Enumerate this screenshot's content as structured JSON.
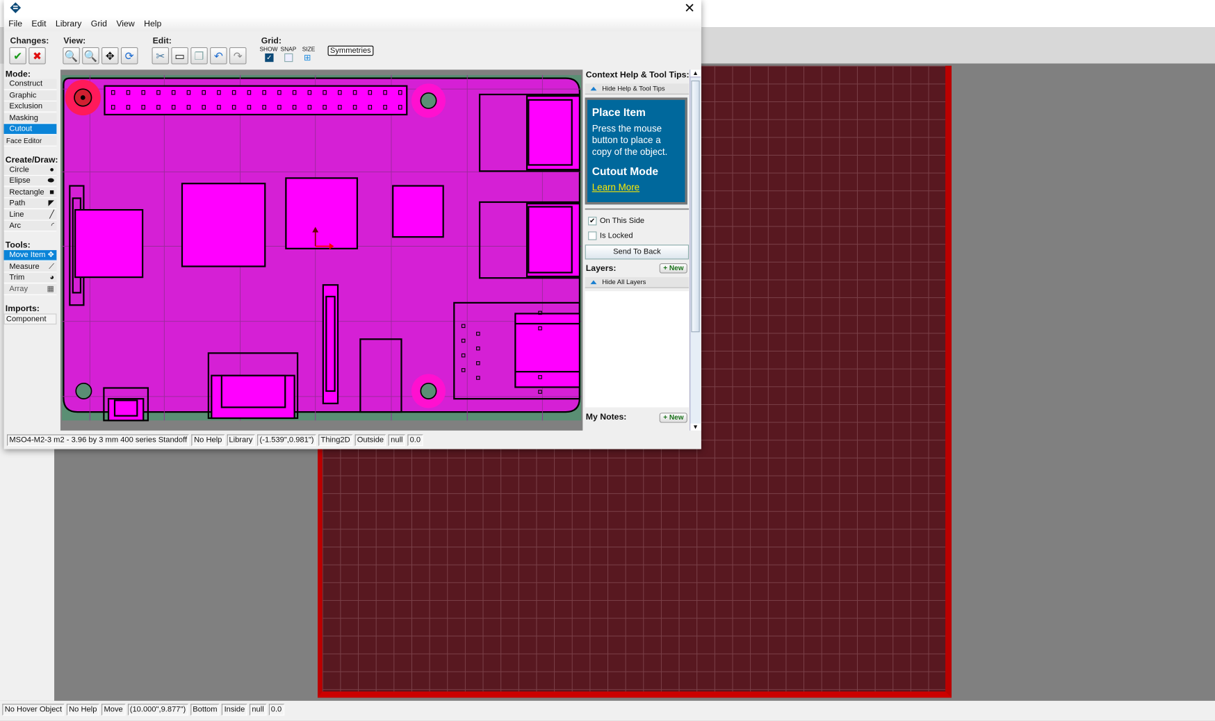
{
  "menu": [
    "File",
    "Edit",
    "Library",
    "Grid",
    "View",
    "Help"
  ],
  "toolbar": {
    "changes": "Changes:",
    "view": "View:",
    "edit": "Edit:",
    "grid": "Grid:",
    "show": "SHOW",
    "snap": "SNAP",
    "size": "SIZE",
    "symmetries": "Symmetries",
    "show_checked": true,
    "snap_checked": false
  },
  "left": {
    "mode_label": "Mode:",
    "modes": [
      "Construct",
      "Graphic",
      "Exclusion",
      "Masking",
      "Cutout",
      "Face Editor"
    ],
    "selected_mode": "Cutout",
    "create_label": "Create/Draw:",
    "create": [
      "Circle",
      "Elipse",
      "Rectangle",
      "Path",
      "Line",
      "Arc"
    ],
    "tools_label": "Tools:",
    "tools": [
      "Move Item",
      "Measure",
      "Trim",
      "Array"
    ],
    "selected_tool": "Move Item",
    "imports_label": "Imports:",
    "imports": [
      "Component"
    ]
  },
  "right": {
    "help_title": "Context Help & Tool Tips:",
    "hide_help": "Hide Help & Tool Tips",
    "tip_title": "Place Item",
    "tip_body": "Press the mouse button to place a copy of the object.",
    "tip_mode": "Cutout Mode",
    "learn_more": "Learn More",
    "on_this_side": "On This Side",
    "on_this_side_checked": true,
    "is_locked": "Is Locked",
    "is_locked_checked": false,
    "send_to_back": "Send To Back",
    "layers": "Layers:",
    "new": "+ New",
    "hide_layers": "Hide All Layers",
    "notes": "My Notes:"
  },
  "status": [
    "MSO4-M2-3 m2 - 3.96 by 3 mm 400 series Standoff",
    "No Help",
    "Library",
    "(-1.539\",0.981\")",
    "Thing2D",
    "Outside",
    "null",
    "0.0"
  ],
  "main_status": [
    "No Hover Object",
    "No Help",
    "Move",
    "(10.000\",9.877\")",
    "Bottom",
    "Inside",
    "null",
    "0.0"
  ],
  "colors": {
    "board": "#d520d5",
    "component": "#ff00ff",
    "help_bg": "#00689c",
    "selection": "#0a84d8",
    "back_board": "#581820"
  }
}
